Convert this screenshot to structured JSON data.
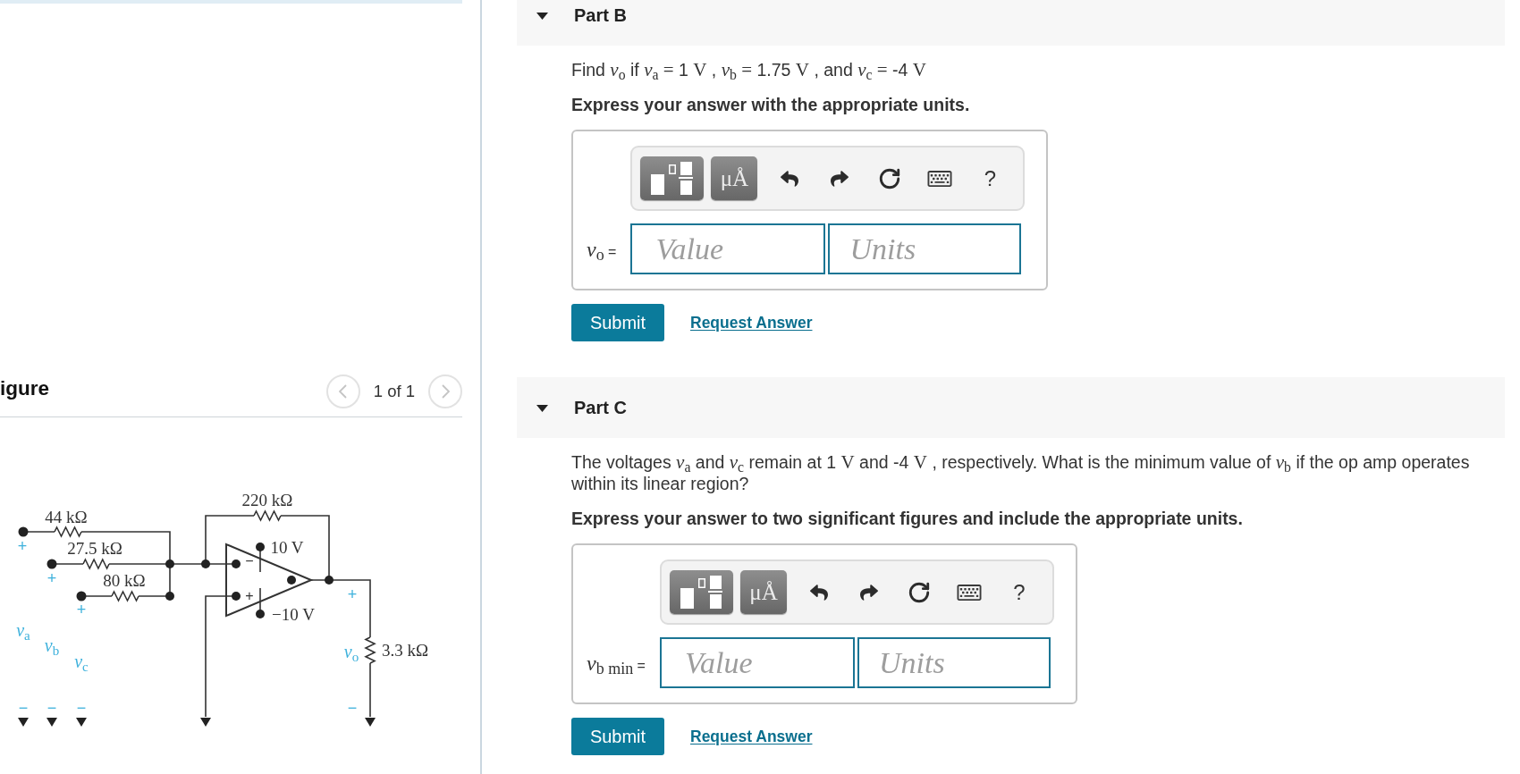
{
  "figure_panel": {
    "title": "igure",
    "pager": {
      "prev_disabled": true,
      "text": "1 of 1",
      "next_disabled": true
    }
  },
  "circuit": {
    "resistors": [
      "44 kΩ",
      "27.5 kΩ",
      "80 kΩ",
      "220 kΩ",
      "3.3 kΩ"
    ],
    "sources": [
      {
        "plus": "+",
        "label": "*v*$_{a}$",
        "minus": "−"
      },
      {
        "plus": "+",
        "label": "*v*$_{b}$",
        "minus": "−"
      },
      {
        "plus": "+",
        "label": "*v*$_{c}$",
        "minus": "−"
      }
    ],
    "op_amp": {
      "inverting_sign": "−",
      "noninverting_sign": "+",
      "supplies": [
        "10 V",
        "−10 V"
      ]
    },
    "output": {
      "plus": "+",
      "label": "*v*$_{o}$",
      "minus": "−"
    }
  },
  "parts": [
    {
      "title": "Part B",
      "expanded": true,
      "question": [
        {
          "kind": "text",
          "text": "Find "
        },
        {
          "kind": "math",
          "text": "*v*$_{o}$"
        },
        {
          "kind": "text",
          "text": " if "
        },
        {
          "kind": "math",
          "text": "*v*$_{a}$ ="
        },
        {
          "kind": "text",
          "text": " 1 "
        },
        {
          "kind": "math",
          "text": "V"
        },
        {
          "kind": "text",
          "text": " , "
        },
        {
          "kind": "math",
          "text": "*v*$_{b}$ ="
        },
        {
          "kind": "text",
          "text": " 1.75 "
        },
        {
          "kind": "math",
          "text": "V"
        },
        {
          "kind": "text",
          "text": " , and "
        },
        {
          "kind": "math",
          "text": "*v*$_{c}$ ="
        },
        {
          "kind": "text",
          "text": " -4 "
        },
        {
          "kind": "math",
          "text": "V"
        }
      ],
      "instruction": "Express your answer with the appropriate units.",
      "answer": {
        "label": [
          {
            "kind": "math",
            "text": "*v*$_{o}$"
          },
          {
            "kind": "text",
            "text": " ="
          }
        ],
        "toolbar": [
          {
            "kind": "templates"
          },
          {
            "kind": "units",
            "label": "μÅ"
          },
          {
            "kind": "undo"
          },
          {
            "kind": "redo"
          },
          {
            "kind": "reset"
          },
          {
            "kind": "keyboard"
          },
          {
            "kind": "help",
            "label": "?"
          }
        ],
        "value": {
          "placeholder": "Value"
        },
        "units": {
          "placeholder": "Units"
        }
      },
      "submit": "Submit",
      "request_answer": "Request Answer"
    },
    {
      "title": "Part C",
      "expanded": true,
      "question": [
        {
          "kind": "text",
          "text": "The voltages "
        },
        {
          "kind": "math",
          "text": "*v*$_{a}$"
        },
        {
          "kind": "text",
          "text": " and "
        },
        {
          "kind": "math",
          "text": "*v*$_{c}$"
        },
        {
          "kind": "text",
          "text": " remain at 1 "
        },
        {
          "kind": "math",
          "text": "V"
        },
        {
          "kind": "text",
          "text": " and -4 "
        },
        {
          "kind": "math",
          "text": "V"
        },
        {
          "kind": "text",
          "text": " , respectively. What is the minimum value of "
        },
        {
          "kind": "math",
          "text": "*v*$_{b}$"
        },
        {
          "kind": "text",
          "text": " if the op amp operates within its linear region?"
        }
      ],
      "instruction": "Express your answer to two significant figures and include the appropriate units.",
      "answer": {
        "label": [
          {
            "kind": "math",
            "text": "*v*$_{b min}$"
          },
          {
            "kind": "text",
            "text": " ="
          }
        ],
        "toolbar": [
          {
            "kind": "templates"
          },
          {
            "kind": "units",
            "label": "μÅ"
          },
          {
            "kind": "undo"
          },
          {
            "kind": "redo"
          },
          {
            "kind": "reset"
          },
          {
            "kind": "keyboard"
          },
          {
            "kind": "help",
            "label": "?"
          }
        ],
        "value": {
          "placeholder": "Value"
        },
        "units": {
          "placeholder": "Units"
        }
      },
      "submit": "Submit",
      "request_answer": "Request Answer"
    }
  ]
}
